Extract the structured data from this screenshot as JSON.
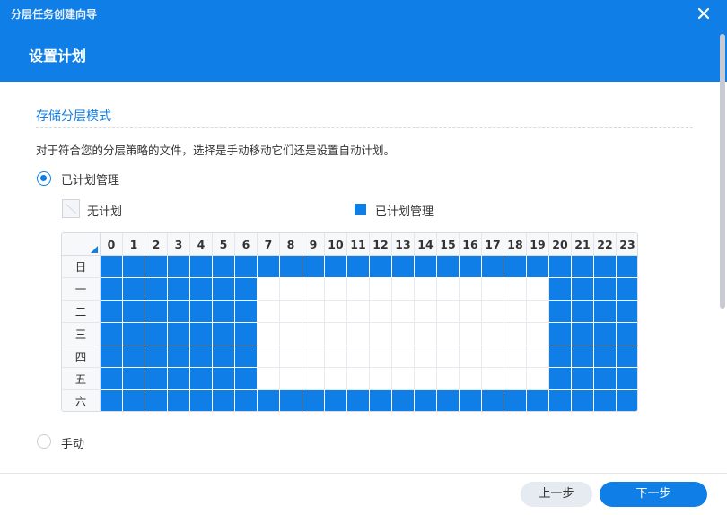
{
  "window": {
    "title": "分层任务创建向导",
    "close_icon": "close-icon"
  },
  "page": {
    "title": "设置计划"
  },
  "section": {
    "title": "存储分层模式",
    "description": "对于符合您的分层策略的文件，选择是手动移动它们还是设置自动计划。"
  },
  "options": {
    "scheduled": {
      "label": "已计划管理",
      "selected": true
    },
    "manual": {
      "label": "手动",
      "selected": false
    }
  },
  "legend": {
    "none_label": "无计划",
    "scheduled_label": "已计划管理",
    "scheduled_color": "#0f7ee6"
  },
  "schedule": {
    "hours": [
      "0",
      "1",
      "2",
      "3",
      "4",
      "5",
      "6",
      "7",
      "8",
      "9",
      "10",
      "11",
      "12",
      "13",
      "14",
      "15",
      "16",
      "17",
      "18",
      "19",
      "20",
      "21",
      "22",
      "23"
    ],
    "days": [
      "日",
      "一",
      "二",
      "三",
      "四",
      "五",
      "六"
    ],
    "rows": [
      [
        1,
        1,
        1,
        1,
        1,
        1,
        1,
        1,
        1,
        1,
        1,
        1,
        1,
        1,
        1,
        1,
        1,
        1,
        1,
        1,
        1,
        1,
        1,
        1
      ],
      [
        1,
        1,
        1,
        1,
        1,
        1,
        1,
        0,
        0,
        0,
        0,
        0,
        0,
        0,
        0,
        0,
        0,
        0,
        0,
        0,
        1,
        1,
        1,
        1
      ],
      [
        1,
        1,
        1,
        1,
        1,
        1,
        1,
        0,
        0,
        0,
        0,
        0,
        0,
        0,
        0,
        0,
        0,
        0,
        0,
        0,
        1,
        1,
        1,
        1
      ],
      [
        1,
        1,
        1,
        1,
        1,
        1,
        1,
        0,
        0,
        0,
        0,
        0,
        0,
        0,
        0,
        0,
        0,
        0,
        0,
        0,
        1,
        1,
        1,
        1
      ],
      [
        1,
        1,
        1,
        1,
        1,
        1,
        1,
        0,
        0,
        0,
        0,
        0,
        0,
        0,
        0,
        0,
        0,
        0,
        0,
        0,
        1,
        1,
        1,
        1
      ],
      [
        1,
        1,
        1,
        1,
        1,
        1,
        1,
        0,
        0,
        0,
        0,
        0,
        0,
        0,
        0,
        0,
        0,
        0,
        0,
        0,
        1,
        1,
        1,
        1
      ],
      [
        1,
        1,
        1,
        1,
        1,
        1,
        1,
        1,
        1,
        1,
        1,
        1,
        1,
        1,
        1,
        1,
        1,
        1,
        1,
        1,
        1,
        1,
        1,
        1
      ]
    ]
  },
  "footer": {
    "prev_label": "上一步",
    "next_label": "下一步"
  },
  "colors": {
    "accent": "#0f7ee6",
    "header_bg": "#0f7ee6"
  }
}
